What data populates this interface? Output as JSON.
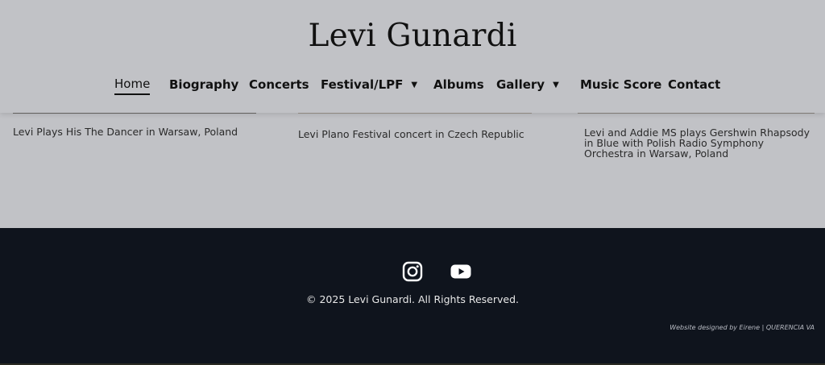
{
  "site": {
    "title": "Levi Gunardi"
  },
  "nav": {
    "items": [
      {
        "label": "Home",
        "active": true
      },
      {
        "label": "Biography"
      },
      {
        "label": "Concerts"
      },
      {
        "label": "Festival/LPF",
        "has_dropdown": true
      },
      {
        "label": "Albums"
      },
      {
        "label": "Gallery",
        "has_dropdown": true
      },
      {
        "label": "Music Score"
      },
      {
        "label": "Contact"
      }
    ]
  },
  "videos": [
    {
      "caption": "Levi Plays His The Dancer in Warsaw, Poland"
    },
    {
      "caption": "Levi Plano Festival concert in Czech Republic"
    },
    {
      "caption": "Levi and Addie MS plays Gershwin Rhapsody in Blue with Polish Radio Symphony Orchestra in Warsaw, Poland"
    }
  ],
  "footer": {
    "social": [
      {
        "icon": "instagram-icon"
      },
      {
        "icon": "youtube-icon"
      }
    ],
    "copyright": "© 2025 Levi Gunardi. All Rights Reserved.",
    "credit": "Website designed by Eirene | QUERENCIA VA"
  },
  "colors": {
    "page_background": "#c1c2c6",
    "footer_background": "#0f141d",
    "text": "#111111",
    "footer_text": "#e8e8e8"
  }
}
